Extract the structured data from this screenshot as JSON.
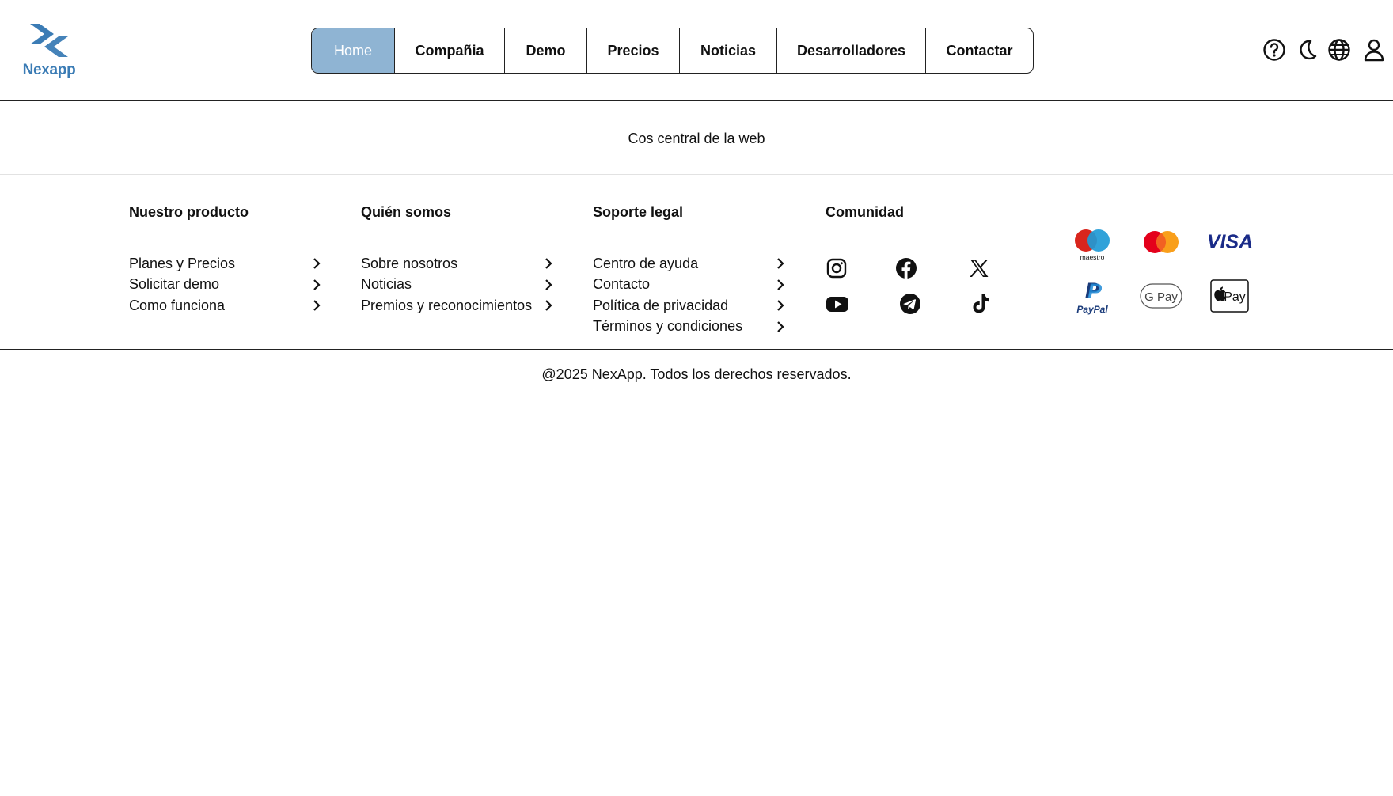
{
  "brand": {
    "name": "Nexapp",
    "color": "#3b7cb5"
  },
  "nav": {
    "items": [
      {
        "label": "Home",
        "active": true
      },
      {
        "label": "Compañia"
      },
      {
        "label": "Demo"
      },
      {
        "label": "Precios"
      },
      {
        "label": "Noticias"
      },
      {
        "label": "Desarrolladores"
      },
      {
        "label": "Contactar"
      }
    ],
    "active_color": "#8fb4d3"
  },
  "header_icons": [
    "help-icon",
    "moon-icon",
    "globe-icon",
    "user-icon"
  ],
  "main": {
    "text": "Cos central de la web"
  },
  "footer": {
    "columns": [
      {
        "title": "Nuestro producto",
        "links": [
          "Planes y Precios",
          "Solicitar demo",
          "Como funciona"
        ]
      },
      {
        "title": "Quién somos",
        "links": [
          "Sobre nosotros",
          "Noticias",
          "Premios y reconocimientos"
        ]
      },
      {
        "title": "Soporte legal",
        "links": [
          "Centro de ayuda",
          "Contacto",
          "Política de privacidad",
          "Términos y condiciones"
        ]
      }
    ],
    "community": {
      "title": "Comunidad",
      "icons": [
        "instagram-icon",
        "facebook-icon",
        "x-icon",
        "youtube-icon",
        "telegram-icon",
        "tiktok-icon"
      ]
    },
    "payments": [
      "maestro",
      "mastercard",
      "VISA",
      "PayPal",
      "G Pay",
      "Pay"
    ],
    "copyright": "@2025 NexApp. Todos los derechos reservados."
  }
}
